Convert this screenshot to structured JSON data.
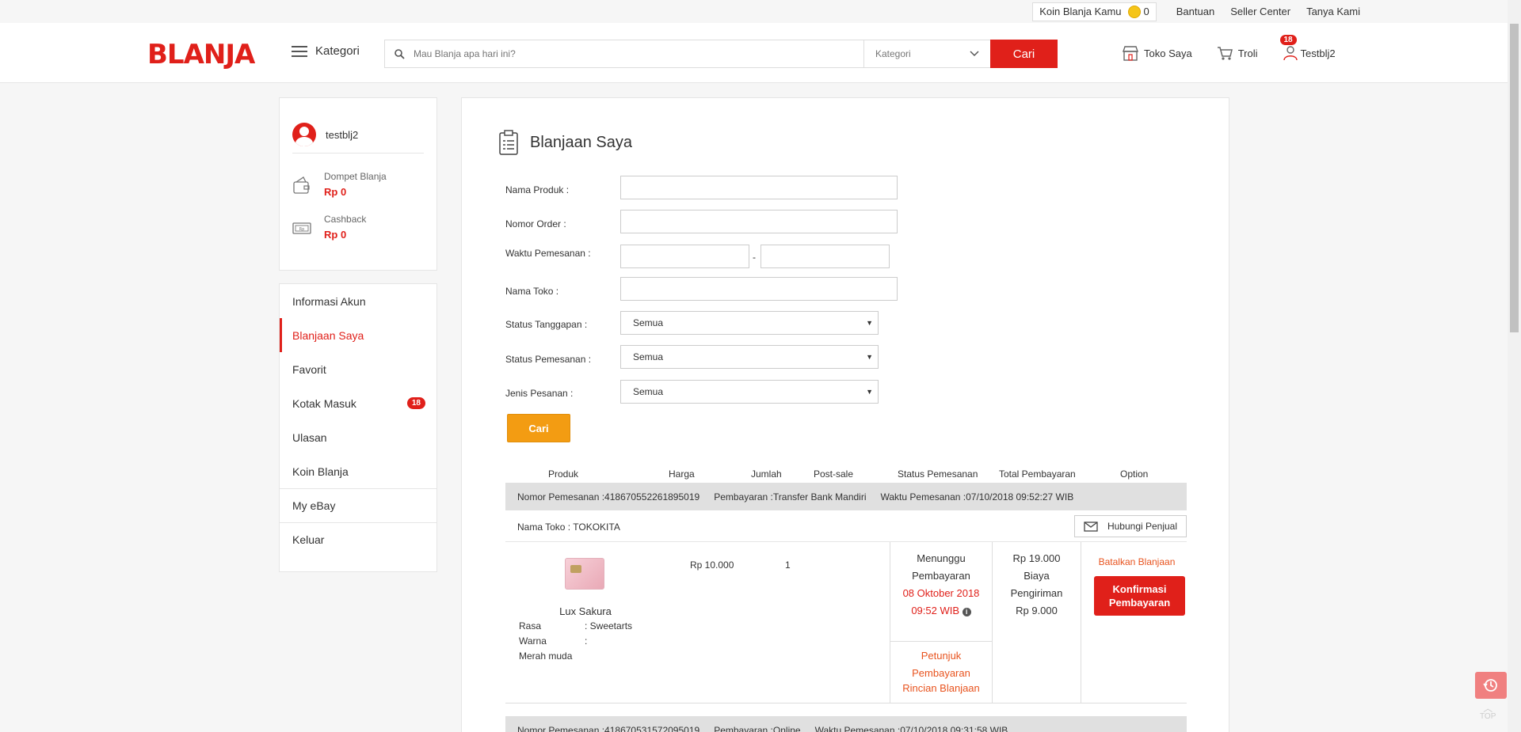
{
  "topbar": {
    "koin_label": "Koin Blanja Kamu",
    "koin_value": "0",
    "links": [
      "Bantuan",
      "Seller Center",
      "Tanya Kami"
    ]
  },
  "header": {
    "logo": "BLANJA",
    "kategori": "Kategori",
    "search_placeholder": "Mau Blanja apa hari ini?",
    "search_category": "Kategori",
    "search_button": "Cari",
    "toko_saya": "Toko Saya",
    "troli": "Troli",
    "user": "Testblj2",
    "badge": "18"
  },
  "sidebar": {
    "username": "testblj2",
    "dompet_label": "Dompet Blanja",
    "dompet_value": "Rp 0",
    "cashback_label": "Cashback",
    "cashback_value": "Rp 0",
    "menu": [
      "Informasi Akun",
      "Blanjaan Saya",
      "Favorit",
      "Kotak Masuk",
      "Ulasan",
      "Koin Blanja",
      "My eBay",
      "Keluar"
    ],
    "kotak_badge": "18"
  },
  "main": {
    "title": "Blanjaan Saya",
    "form": {
      "nama_produk": "Nama Produk :",
      "nomor_order": "Nomor Order :",
      "waktu": "Waktu Pemesanan :",
      "dash": "-",
      "nama_toko": "Nama Toko :",
      "status_tanggapan": "Status Tanggapan :",
      "status_pemesanan": "Status Pemesanan :",
      "jenis_pesanan": "Jenis Pesanan :",
      "select_value": "Semua",
      "button": "Cari"
    },
    "columns": [
      "Produk",
      "Harga",
      "Jumlah",
      "Post-sale",
      "Status Pemesanan",
      "Total Pembayaran",
      "Option"
    ],
    "order1": {
      "nomor": "Nomor Pemesanan :418670552261895019",
      "pembayaran": "Pembayaran :Transfer Bank Mandiri",
      "waktu": "Waktu Pemesanan :07/10/2018 09:52:27 WIB",
      "toko": "Nama Toko  : TOKOKITA",
      "hubungi": "Hubungi Penjual",
      "product_name": "Lux Sakura",
      "rasa_label": "Rasa",
      "rasa_value": ": Sweetarts",
      "warna_label": "Warna",
      "warna_value": ":",
      "warna_extra": "Merah muda",
      "harga": "Rp 10.000",
      "jumlah": "1",
      "status1": "Menunggu",
      "status2": "Pembayaran",
      "deadline1": "08 Oktober 2018",
      "deadline2": "09:52 WIB",
      "petunjuk1": "Petunjuk",
      "petunjuk2": "Pembayaran",
      "rincian": "Rincian Blanjaan",
      "total": "Rp 19.000",
      "biaya1": "Biaya",
      "biaya2": "Pengiriman",
      "biaya_value": "Rp 9.000",
      "batalkan": "Batalkan Blanjaan",
      "konfirmasi1": "Konfirmasi",
      "konfirmasi2": "Pembayaran"
    },
    "order2": {
      "nomor": "Nomor Pemesanan :418670531572095019",
      "pembayaran": "Pembayaran :Online",
      "waktu": "Waktu Pemesanan :07/10/2018 09:31:58 WIB"
    }
  },
  "footer": {
    "top": "TOP"
  }
}
